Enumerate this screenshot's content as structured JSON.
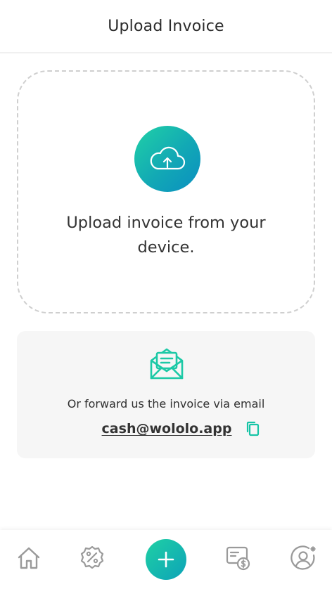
{
  "header": {
    "title": "Upload Invoice"
  },
  "upload": {
    "message": "Upload invoice from your device.",
    "icon": "cloud-upload-icon"
  },
  "email_card": {
    "forward_text": "Or forward us the invoice via email",
    "email": "cash@wololo.app",
    "mail_icon": "open-envelope-icon",
    "copy_icon": "copy-icon"
  },
  "bottom_nav": {
    "items": [
      "home-icon",
      "discount-badge-icon",
      "add-icon",
      "invoice-dollar-icon",
      "profile-settings-icon"
    ]
  },
  "colors": {
    "accent": "#17bca8",
    "accent_dark": "#0a8fc1",
    "icon_gray": "#9a9a9a",
    "card_bg": "#f6f6f6"
  }
}
